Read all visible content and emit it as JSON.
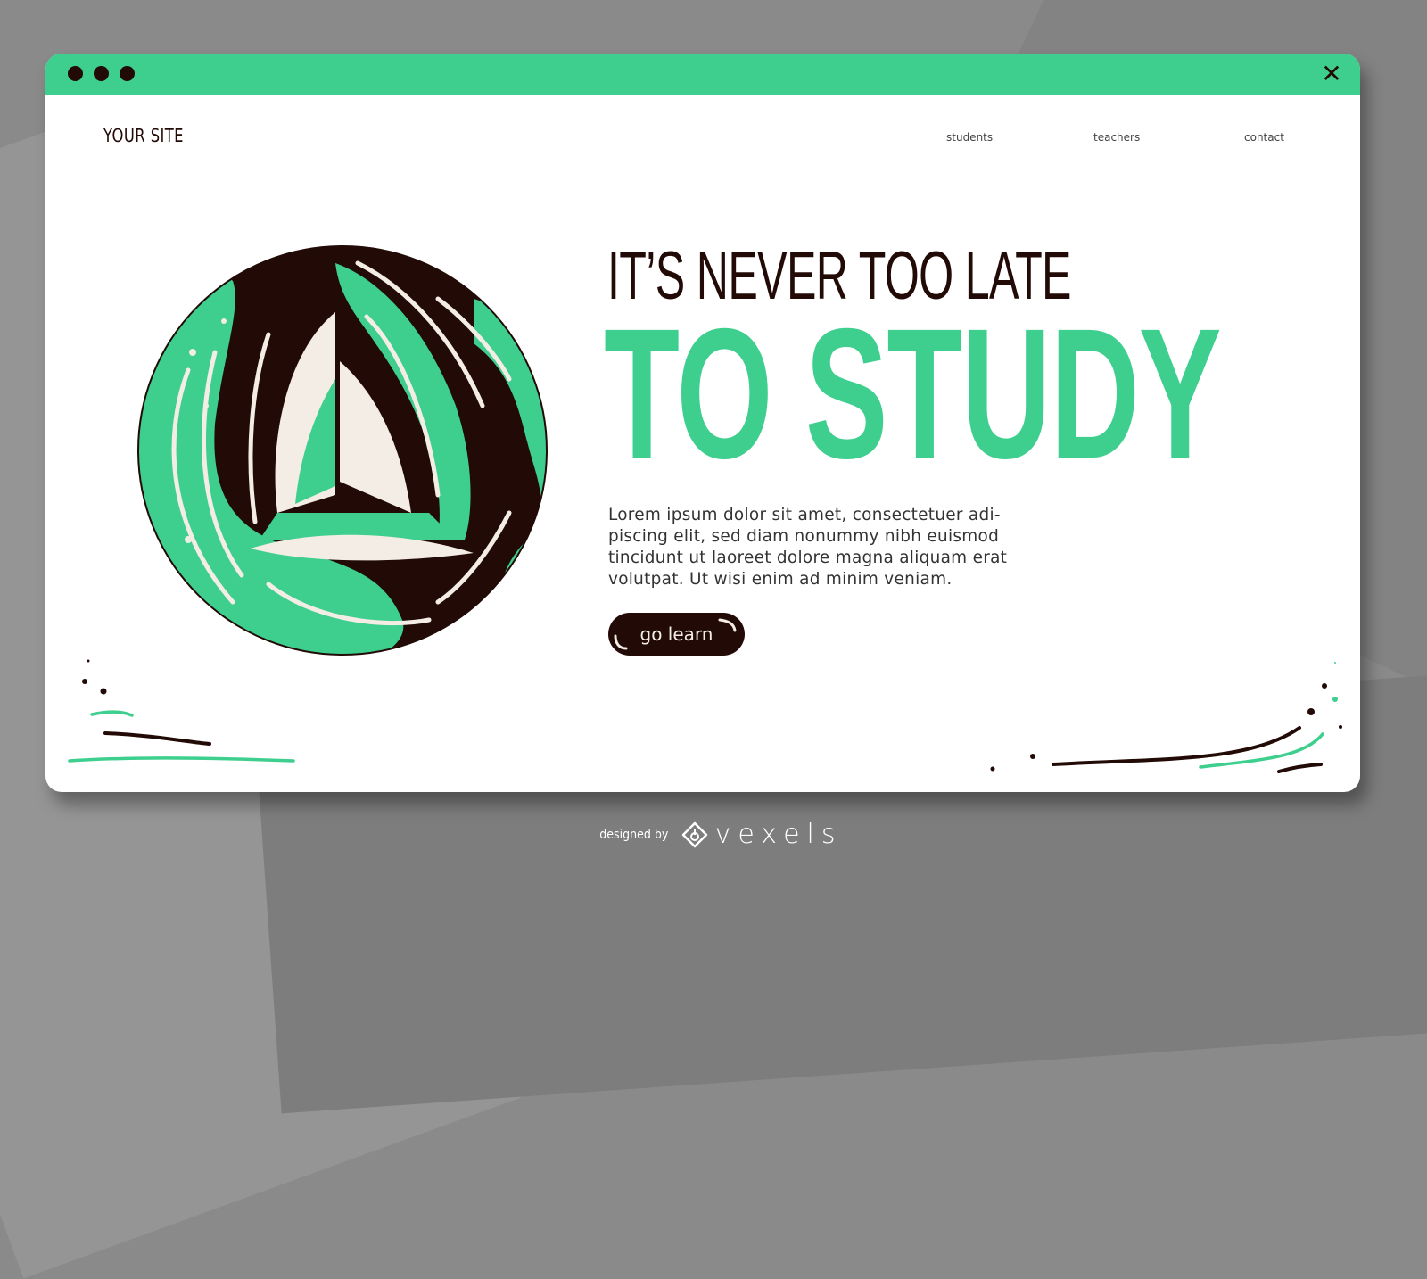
{
  "window": {
    "controls": [
      "dot",
      "dot",
      "dot"
    ],
    "close_icon": "close-icon"
  },
  "header": {
    "logo": "YOUR SITE",
    "nav": [
      {
        "label": "students"
      },
      {
        "label": "teachers"
      },
      {
        "label": "contact"
      }
    ]
  },
  "hero": {
    "headline_line1": "IT’S NEVER TOO LATE",
    "headline_line2": "TO STUDY",
    "body": "Lorem ipsum dolor sit amet, consectetuer adi-piscing elit, sed diam nonummy nibh euismod tincidunt ut laoreet dolore magna aliquam erat volutpat. Ut wisi enim ad minim veniam.",
    "body_lines": [
      "Lorem ipsum dolor sit amet, consectetuer adi-",
      "piscing elit, sed diam nonummy nibh euismod",
      "tincidunt ut laoreet dolore magna aliquam erat",
      "volutpat. Ut wisi enim ad minim veniam."
    ],
    "cta_label": "go learn",
    "illustration": "tunnel-globe-illustration"
  },
  "credit": {
    "prefix": "designed by",
    "brand": "vexels"
  },
  "colors": {
    "accent": "#3ecf8e",
    "dark": "#220a06",
    "cream": "#f3ede6",
    "background": "#8a8a8a",
    "window": "#ffffff"
  }
}
